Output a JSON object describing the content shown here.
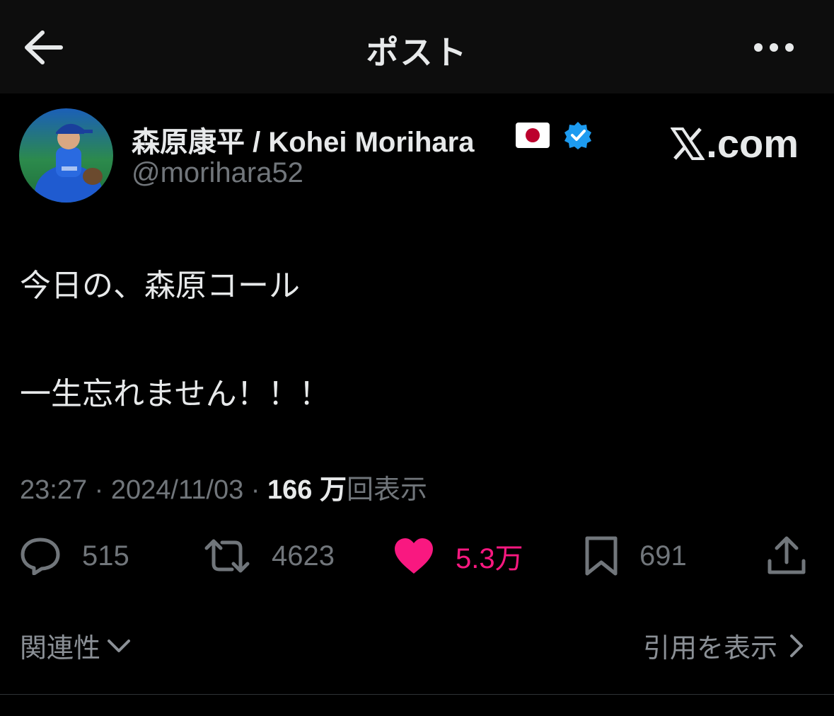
{
  "header": {
    "title": "ポスト",
    "back_icon": "arrow-left-icon",
    "more_icon": "more-horizontal-icon"
  },
  "author": {
    "display_name": "森原康平 / Kohei Morihara",
    "flag": "🇯🇵",
    "verified": true,
    "handle": "@morihara52",
    "avatar": "avatar-photo"
  },
  "watermark": {
    "text": ".com",
    "logo": "x-logo"
  },
  "post": {
    "lines": [
      "今日の、森原コール",
      "一生忘れません！！！"
    ]
  },
  "meta": {
    "time": "23:27",
    "date": "2024/11/03",
    "separator": " · ",
    "views_count": "166 万",
    "views_label": "回表示"
  },
  "actions": {
    "replies": "515",
    "reposts": "4623",
    "likes": "5.3万",
    "bookmarks": "691"
  },
  "footer": {
    "related_label": "関連性",
    "quotes_label": "引用を表示"
  },
  "colors": {
    "background": "#000000",
    "header_bg": "#0d0d0d",
    "text": "#e7e9ea",
    "muted": "#71767b",
    "like": "#f91880",
    "verified": "#1d9bf0"
  }
}
